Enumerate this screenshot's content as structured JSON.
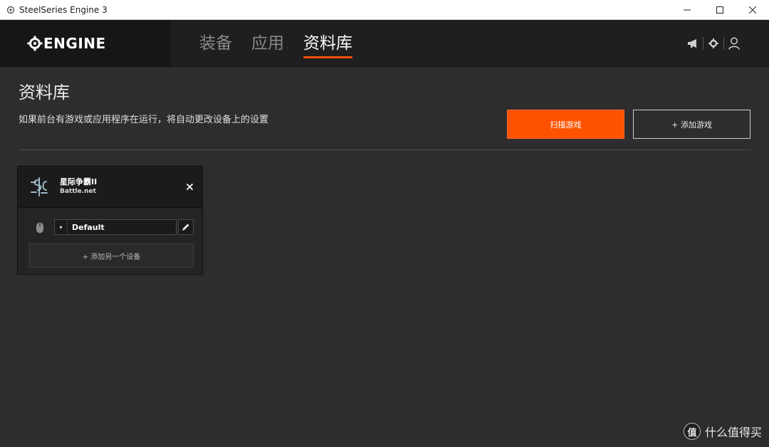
{
  "window": {
    "title": "SteelSeries Engine 3",
    "controls": {
      "minimize": "minimize",
      "maximize": "maximize",
      "close": "close"
    }
  },
  "header": {
    "brand": "ENGINE",
    "tabs": [
      {
        "label": "装备",
        "active": false
      },
      {
        "label": "应用",
        "active": false
      },
      {
        "label": "资料库",
        "active": true
      }
    ],
    "icons": [
      "megaphone-icon",
      "gear-icon",
      "user-icon"
    ]
  },
  "library": {
    "title": "资料库",
    "subtitle": "如果前台有游戏或应用程序在运行，将自动更改设备上的设置",
    "scan_button": "扫描游戏",
    "add_button": "+ 添加游戏"
  },
  "game_card": {
    "name": "星际争霸II",
    "platform": "Battle.net",
    "profile": "Default",
    "add_device": "+ 添加另一个设备"
  },
  "watermark": {
    "logo": "值",
    "text": "什么值得买"
  },
  "colors": {
    "accent": "#ff5200",
    "background": "#2d2d2d",
    "header": "#1f1f1f"
  }
}
